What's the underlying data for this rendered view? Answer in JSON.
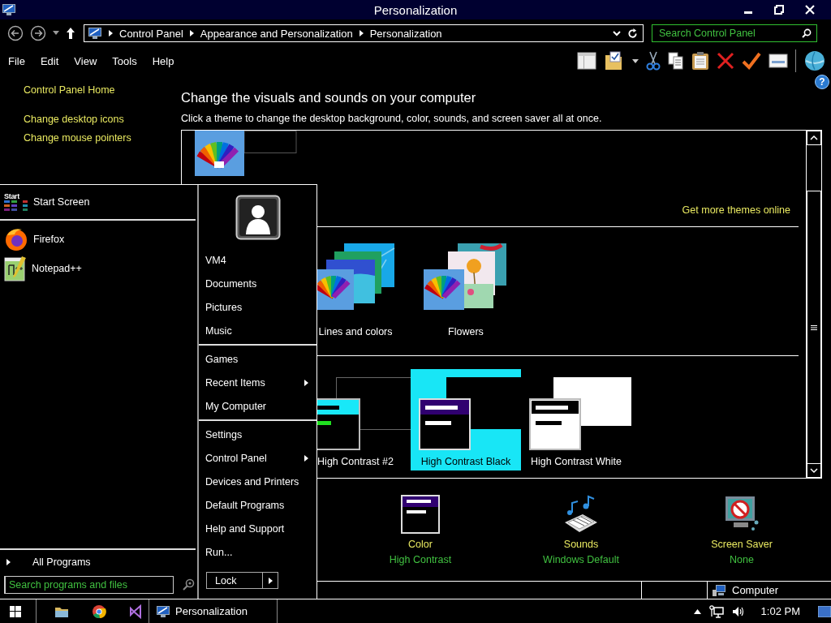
{
  "window": {
    "title": "Personalization"
  },
  "address_bar": {
    "breadcrumb": [
      "Control Panel",
      "Appearance and Personalization",
      "Personalization"
    ]
  },
  "search": {
    "placeholder": "Search Control Panel"
  },
  "menu": [
    "File",
    "Edit",
    "View",
    "Tools",
    "Help"
  ],
  "help_button": "?",
  "sidebar": {
    "links": [
      "Control Panel Home",
      "Change desktop icons",
      "Change mouse pointers"
    ]
  },
  "heading": "Change the visuals and sounds on your computer",
  "subtitle": "Click a theme to change the desktop background, color, sounds, and screen saver all at once.",
  "get_more_link": "Get more themes online",
  "themes": [
    {
      "label": "Lines and colors",
      "kind": "lines",
      "selected": false
    },
    {
      "label": "Flowers",
      "kind": "flowers",
      "selected": false
    }
  ],
  "high_contrast_themes": [
    {
      "label": "High Contrast #2",
      "kind": "hc2",
      "selected": false
    },
    {
      "label": "High Contrast Black",
      "kind": "hcblack",
      "selected": true
    },
    {
      "label": "High Contrast White",
      "kind": "hcwhite",
      "selected": false
    }
  ],
  "settings": [
    {
      "kind": "color",
      "title": "Color",
      "value": "High Contrast"
    },
    {
      "kind": "sounds",
      "title": "Sounds",
      "value": "Windows Default"
    },
    {
      "kind": "screensaver",
      "title": "Screen Saver",
      "value": "None"
    }
  ],
  "status_bar": {
    "location": "Computer"
  },
  "start_menu": {
    "pinned": [
      {
        "kind": "startscreen",
        "label": "Start Screen",
        "icon_text": "Start"
      },
      {
        "kind": "firefox",
        "label": "Firefox"
      },
      {
        "kind": "notepad",
        "label": "Notepad++"
      }
    ],
    "all_programs": "All Programs",
    "search": {
      "placeholder": "Search programs and files"
    },
    "groups": [
      [
        {
          "label": "VM4",
          "kind": "command"
        },
        {
          "label": "Documents",
          "kind": "command"
        },
        {
          "label": "Pictures",
          "kind": "command"
        },
        {
          "label": "Music",
          "kind": "command"
        }
      ],
      [
        {
          "label": "Games",
          "kind": "command"
        },
        {
          "label": "Recent Items",
          "kind": "submenu"
        },
        {
          "label": "My Computer",
          "kind": "command"
        }
      ],
      [
        {
          "label": "Settings",
          "kind": "command"
        },
        {
          "label": "Control Panel",
          "kind": "submenu"
        },
        {
          "label": "Devices and Printers",
          "kind": "command"
        },
        {
          "label": "Default Programs",
          "kind": "command"
        },
        {
          "label": "Help and Support",
          "kind": "command"
        },
        {
          "label": "Run...",
          "kind": "command"
        }
      ]
    ],
    "lock_button": "Lock"
  },
  "taskbar": {
    "window_button": "Personalization",
    "time": "1:02 PM"
  }
}
